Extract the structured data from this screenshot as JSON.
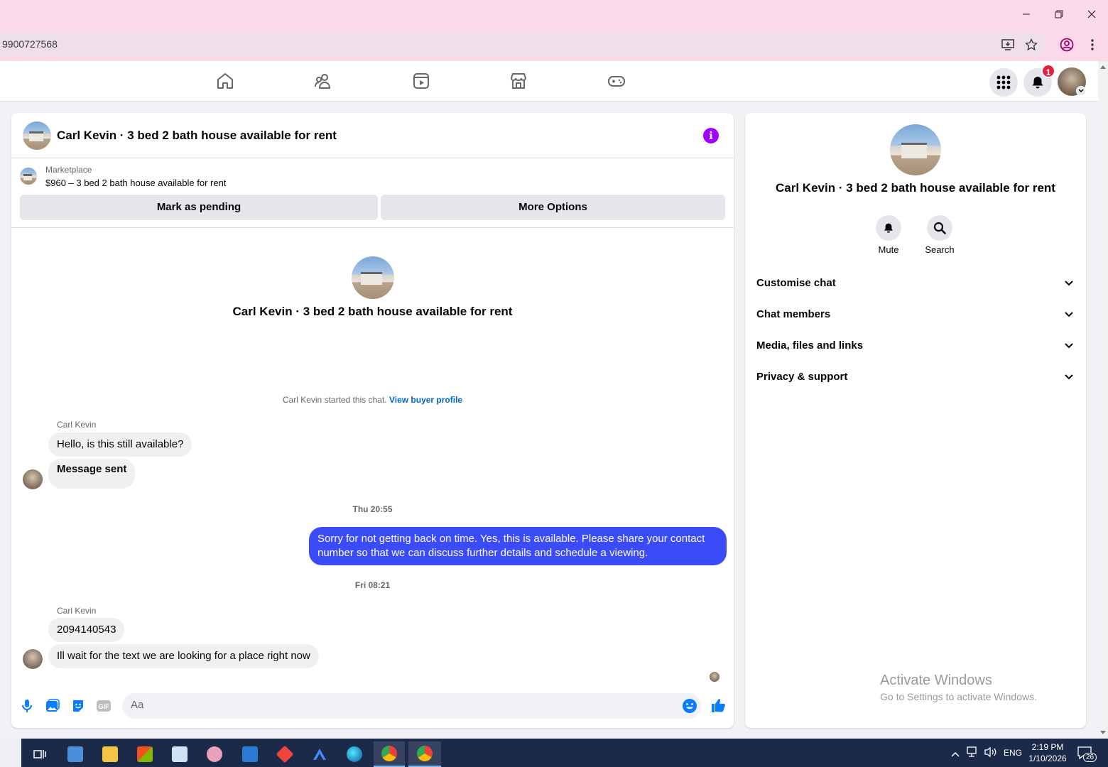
{
  "browser": {
    "url": "9900727568"
  },
  "nav": {
    "notification_count": "1"
  },
  "chat": {
    "title": "Carl Kevin · 3 bed 2 bath house available for rent",
    "marketplace_label": "Marketplace",
    "listing": "$960 – 3 bed 2 bath house available for rent",
    "mark_pending": "Mark as pending",
    "more_options": "More Options",
    "intro_title": "Carl Kevin · 3 bed 2 bath house available for rent",
    "started_text": "Carl Kevin started this chat.",
    "view_profile": "View buyer profile",
    "sender_name_1": "Carl Kevin",
    "msg_1": "Hello, is this still available?",
    "msg_2": "Message sent",
    "time_1": "Thu 20:55",
    "msg_out": "Sorry for not getting back on time. Yes, this is available. Please share your contact number so that we can discuss further details and schedule a viewing.",
    "time_2": "Fri 08:21",
    "sender_name_2": "Carl Kevin",
    "msg_3": "2094140543",
    "msg_4": "Ill wait for the text we are looking for a place right now",
    "composer_placeholder": "Aa"
  },
  "info": {
    "title": "Carl Kevin · 3 bed 2 bath house available for rent",
    "mute": "Mute",
    "search": "Search",
    "sections": [
      "Customise chat",
      "Chat members",
      "Media, files and links",
      "Privacy & support"
    ]
  },
  "watermark": {
    "line1": "Activate Windows",
    "line2": "Go to Settings to activate Windows."
  },
  "taskbar": {
    "lang": "ENG",
    "time": "2:19 PM",
    "date": "1/10/2026",
    "notif_count": "26"
  },
  "colors": {
    "accent": "#3a4bf7",
    "info_purple": "#a100ff",
    "title_bar": "#fbd8ea"
  }
}
